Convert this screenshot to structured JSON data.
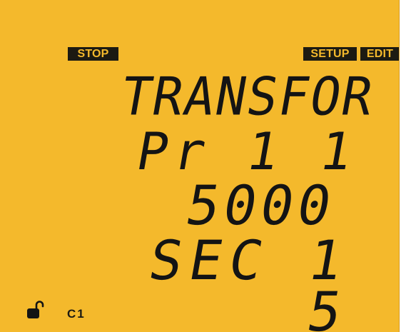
{
  "indicators": {
    "stop": "STOP",
    "setup": "SETUP",
    "edit": "EDIT",
    "channel": "C1",
    "lock_icon": "unlocked-padlock"
  },
  "display": {
    "line1": "TRANSFOR",
    "line2": "Pr 1 1",
    "line3": "5000",
    "line4": "SEC 1",
    "line5": "5"
  },
  "colors": {
    "lcd_background": "#f4b92c",
    "segment": "#141414"
  }
}
